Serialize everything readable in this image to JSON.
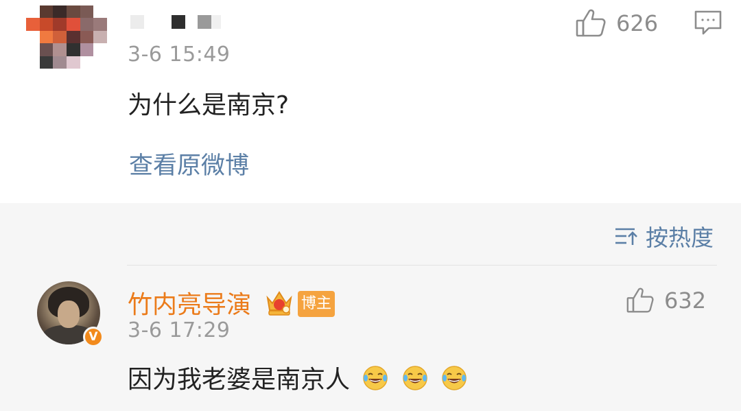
{
  "comment": {
    "timestamp": "3-6 15:49",
    "text": "为什么是南京?",
    "like_count": "626",
    "view_original_link": "查看原微博",
    "icons": [
      "thumbs-up-icon",
      "reply-icon"
    ]
  },
  "sort": {
    "label": "按热度",
    "icon": "sort-icon"
  },
  "reply": {
    "author": "竹内亮导演",
    "badge": "博主",
    "timestamp": "3-6 17:29",
    "text": "因为我老婆是南京人",
    "emojis": [
      "laughing-crying-emoji",
      "laughing-crying-emoji",
      "laughing-crying-emoji"
    ],
    "like_count": "632",
    "verified_badge": "V",
    "icons": [
      "crown-icon",
      "thumbs-up-icon"
    ]
  },
  "colors": {
    "link_blue": "#5b7fa6",
    "author_orange": "#eb7b1a",
    "badge_orange": "#f5a33f",
    "muted_gray": "#9a9a9a",
    "section_bg": "#f6f6f6"
  }
}
